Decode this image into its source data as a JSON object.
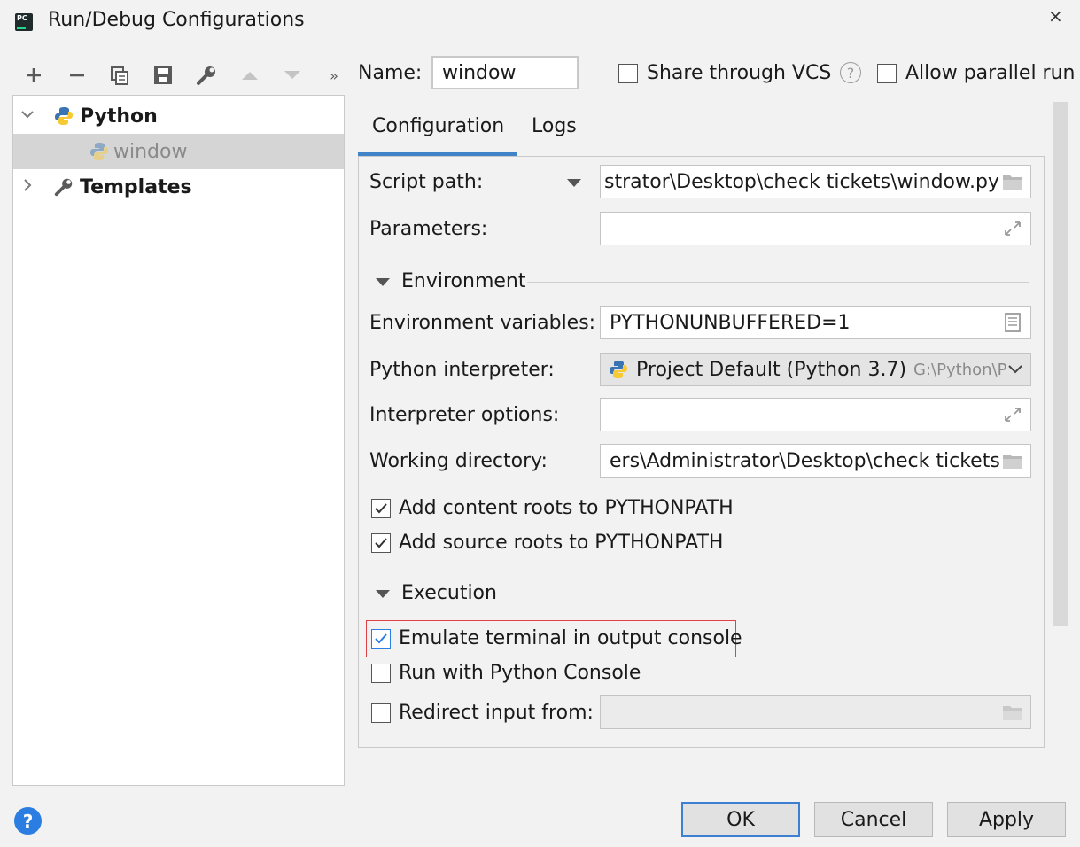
{
  "window": {
    "title": "Run/Debug Configurations",
    "close": "×"
  },
  "toolbar": {
    "add": "+",
    "remove": "−",
    "more": "»"
  },
  "tree": {
    "python": "Python",
    "window": "window",
    "templates": "Templates"
  },
  "name": {
    "label": "Name:",
    "value": "window"
  },
  "share_vcs": {
    "label": "Share through VCS",
    "checked": false
  },
  "help_q": "?",
  "allow_parallel": {
    "label": "Allow parallel run",
    "checked": false
  },
  "tabs": {
    "configuration": "Configuration",
    "logs": "Logs"
  },
  "script_path": {
    "label": "Script path:",
    "value": "strator\\Desktop\\check tickets\\window.py"
  },
  "parameters": {
    "label": "Parameters:",
    "value": ""
  },
  "environment": {
    "title": "Environment",
    "env_vars_label": "Environment variables:",
    "env_vars_value": "PYTHONUNBUFFERED=1",
    "interpreter_label": "Python interpreter:",
    "interpreter_value": "Project Default (Python 3.7)",
    "interpreter_path": "G:\\Python\\P",
    "interp_options_label": "Interpreter options:",
    "interp_options_value": "",
    "working_dir_label": "Working directory:",
    "working_dir_value": "ers\\Administrator\\Desktop\\check tickets"
  },
  "add_content_roots": {
    "label": "Add content roots to PYTHONPATH",
    "checked": true
  },
  "add_source_roots": {
    "label": "Add source roots to PYTHONPATH",
    "checked": true
  },
  "execution": {
    "title": "Execution"
  },
  "emulate_terminal": {
    "label": "Emulate terminal in output console",
    "checked": true
  },
  "run_python_console": {
    "label": "Run with Python Console",
    "checked": false
  },
  "redirect_input": {
    "label": "Redirect input from:",
    "checked": false,
    "value": ""
  },
  "buttons": {
    "ok": "OK",
    "cancel": "Cancel",
    "apply": "Apply",
    "help": "?"
  },
  "colors": {
    "accent": "#4083c9",
    "highlight": "#e04141",
    "check_blue": "#2b7de1"
  }
}
